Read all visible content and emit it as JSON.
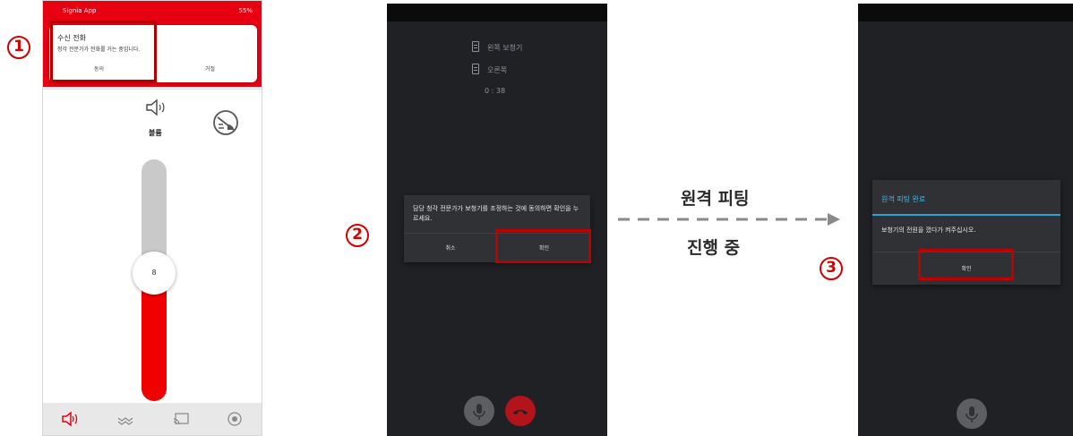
{
  "steps": {
    "one": "1",
    "two": "2",
    "three": "3"
  },
  "phone1": {
    "status_left": "Signia App",
    "status_right": "55%",
    "incoming_call": {
      "title": "수신 전화",
      "message": "청각 전문가가 전화를 거는 중입니다.",
      "accept": "동의",
      "decline": "거절"
    },
    "mute_label": "볼륨",
    "volume_value": "8",
    "volume_fraction": 0.54,
    "nav_icons": [
      "speaker-icon",
      "equalizer-icon",
      "cast-icon",
      "target-icon"
    ]
  },
  "phone2": {
    "device_left": "왼쪽 보청기",
    "device_right": "오른쪽",
    "call_timer": "0 : 38",
    "dialog": {
      "message": "담당 청각 전문가가 보청기를 조정하는 것에 동의하면 확인을 누르세요.",
      "cancel": "취소",
      "confirm": "확인"
    }
  },
  "middle": {
    "top_label": "원격 피팅",
    "bottom_label": "진행 중"
  },
  "phone3": {
    "dialog": {
      "title": "원격 피팅 완료",
      "message": "보청기의 전원을 껐다가 켜주십시오.",
      "confirm": "확인"
    }
  },
  "colors": {
    "signia_red": "#e60012",
    "highlight": "#c00000",
    "dialog_accent": "#41b8e6",
    "dark_bg": "#1f2124"
  }
}
